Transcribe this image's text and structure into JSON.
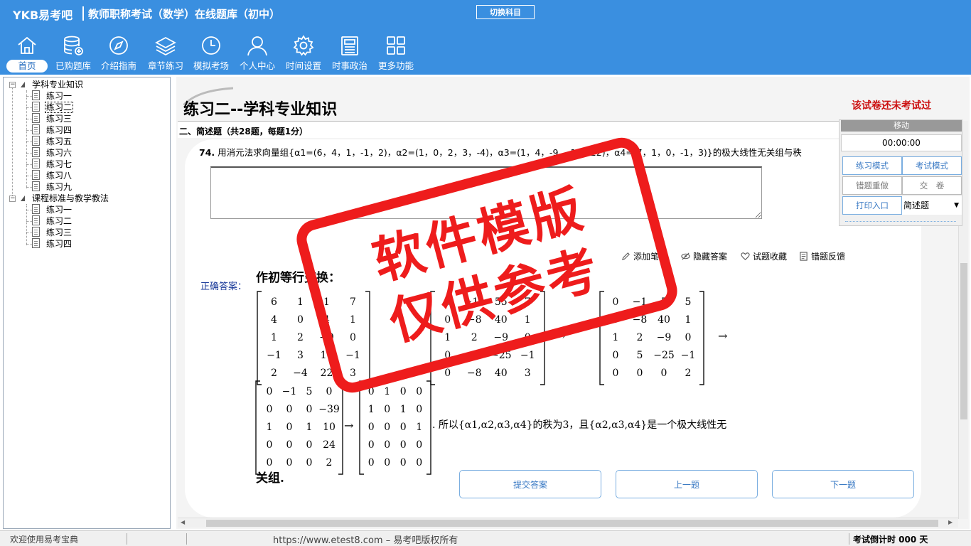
{
  "header": {
    "logo": "YKB易考吧",
    "title": "教师职称考试（数学）在线题库（初中）",
    "switch_subject": "切换科目"
  },
  "nav": {
    "items": [
      {
        "label": "首页",
        "icon": "home-icon"
      },
      {
        "label": "已购题库",
        "icon": "database-icon"
      },
      {
        "label": "介绍指南",
        "icon": "compass-icon"
      },
      {
        "label": "章节练习",
        "icon": "layers-icon"
      },
      {
        "label": "模拟考场",
        "icon": "clock-icon"
      },
      {
        "label": "个人中心",
        "icon": "user-icon"
      },
      {
        "label": "时间设置",
        "icon": "gear-icon"
      },
      {
        "label": "时事政治",
        "icon": "news-icon"
      },
      {
        "label": "更多功能",
        "icon": "grid-icon"
      }
    ]
  },
  "tree": {
    "groups": [
      {
        "label": "学科专业知识",
        "items": [
          "练习一",
          "练习二",
          "练习三",
          "练习四",
          "练习五",
          "练习六",
          "练习七",
          "练习八",
          "练习九"
        ]
      },
      {
        "label": "课程标准与教学教法",
        "items": [
          "练习一",
          "练习二",
          "练习三",
          "练习四"
        ]
      }
    ],
    "selected": "练习二"
  },
  "main": {
    "title": "练习二--学科专业知识",
    "status": "该试卷还未考试过",
    "section": "二、简述题（共28题，每题1分）",
    "question_number": "74.",
    "question_text": "用消元法求向量组{α1=(6，4，1，-1，2)，α2=(1，0，2，3，-4)，α3=(1，4，-9，-16，22)，α4=(7，1，0，-1，3)}的极大线性无关组与秩",
    "tools": {
      "add_note": "添加笔记",
      "hide_answer": "隐藏答案",
      "favorite": "试题收藏",
      "feedback": "错题反馈"
    },
    "correct_answer_label": "正确答案：",
    "answer": {
      "heading": "作初等行变换：",
      "matrix_a": [
        "6 1 1 7",
        "4 0 4 1",
        "1 2 −9 0",
        "−1 3 16 −1",
        "2 −4 22 3"
      ],
      "matrix_b": [
        "0 −11 55 7",
        "0 −8 40 1",
        "1 2 −9 0",
        "0 5 −25 −1",
        "0 −8 40 3"
      ],
      "matrix_c": [
        "0 −1 5 5",
        "0 −8 40 1",
        "1 2 −9 0",
        "0 5 −25 −1",
        "0 0 0 2"
      ],
      "matrix_d": [
        "0 −1 5 0",
        "0 0 0 −39",
        "1 0 1 10",
        "0 0 0 24",
        "0 0 0 2"
      ],
      "matrix_e": [
        "0 1 0 0",
        "1 0 1 0",
        "0 0 0 1",
        "0 0 0 0",
        "0 0 0 0"
      ],
      "conclusion": ". 所以{α1,α2,α3,α4}的秩为3，且{α2,α3,α4}是一个极大线性无",
      "conclusion_end": "关组.",
      "arrow": "→"
    },
    "buttons": {
      "submit": "提交答案",
      "prev": "上一题",
      "next": "下一题"
    }
  },
  "float_panel": {
    "move": "移动",
    "timer": "00:00:00",
    "practice_mode": "练习模式",
    "exam_mode": "考试模式",
    "redo_wrong": "错题重做",
    "submit_paper": "交　卷",
    "print": "打印入口",
    "type_value": "简述题"
  },
  "statusbar": {
    "welcome": "欢迎使用易考宝典",
    "url": "https://www.etest8.com – 易考吧版权所有",
    "countdown": "考试倒计时 000 天"
  },
  "watermark": {
    "line1": "软件模版",
    "line2": "仅供参考",
    "color": "#ee1c1c"
  },
  "colors": {
    "header_bg": "#3a8fe0",
    "accent": "#3a7ac4",
    "alert": "#cc1111"
  }
}
